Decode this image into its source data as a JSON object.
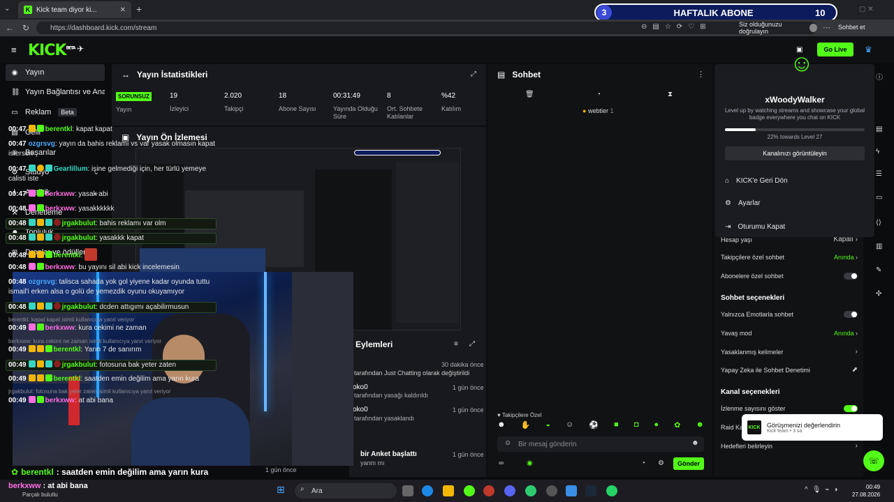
{
  "browser": {
    "tab_title": "Kick team diyor ki...",
    "url": "https://dashboard.kick.com/stream",
    "verify_label": "Siz olduğunuzu doğrulayın",
    "subscribe_label": "Sohbet et"
  },
  "sub_overlay": {
    "count_left": "3",
    "label": "HAFTALIK ABONE",
    "count_right": "10"
  },
  "header": {
    "logo": "KICK",
    "logo_sup": "BETA",
    "go_live": "Go Live"
  },
  "sidebar": {
    "items": [
      {
        "label": "Yayın"
      },
      {
        "label": "Yayın Bağlantısı ve Anahtarı"
      },
      {
        "label": "Reklam",
        "badge": "Beta"
      },
      {
        "label": "Gelir"
      },
      {
        "label": "Başarılar"
      },
      {
        "label": "Stüdyo"
      },
      {
        "label": "Analitik"
      },
      {
        "label": "Denetleme"
      },
      {
        "label": "Topluluk"
      },
      {
        "label": "Droplar ve ödüller"
      }
    ]
  },
  "stats": {
    "title": "Yayın İstatistikleri",
    "badge": "SORUNSUZ",
    "items": [
      {
        "value": "",
        "label": "Yayın"
      },
      {
        "value": "19",
        "label": "İzleyici"
      },
      {
        "value": "2.020",
        "label": "Takipçi"
      },
      {
        "value": "18",
        "label": "Abone Sayısı"
      },
      {
        "value": "00:31:49",
        "label": "Yayında Olduğu Süre"
      },
      {
        "value": "8",
        "label": "Ort. Sohbete Katılanlar"
      },
      {
        "value": "%42",
        "label": "Katılım"
      }
    ]
  },
  "preview": {
    "title": "Yayın Ön İzlemesi"
  },
  "actions": {
    "title": "Eylemleri",
    "rows": [
      {
        "time": "30 dakika önce",
        "text": "tarafından Just Chatting olarak değiştirildi"
      },
      {
        "time": "1 gün önce",
        "text": "oko0",
        "sub": "tarafından yasağı kaldırıldı"
      },
      {
        "time": "1 gün önce",
        "text": "oko0",
        "sub": "tarafından yasaklandı"
      },
      {
        "time": "1 gün önce",
        "text": "bir Anket başlattı",
        "sub": "yanm mı"
      },
      {
        "time": "1 gün önce",
        "text": ""
      }
    ]
  },
  "chat": {
    "title": "Sohbet",
    "pinned": "webtier",
    "pinned_count": "1",
    "messages": [
      {
        "time": "00:47",
        "user": "berentkl",
        "color": "#53fc18",
        "text": "kapat kapat",
        "hl": false
      },
      {
        "time": "00:47",
        "user": "ozgrsvg",
        "color": "#4aa8ff",
        "text": "yayın da bahis reklamı vs var yasak olmasın kapat istersen",
        "hl": false
      },
      {
        "time": "00:47",
        "user": "Gearlillum",
        "color": "#38d6c2",
        "text": "işine gelmediği için, her türlü yemeye calisti iste",
        "hl": false
      },
      {
        "time": "00:47",
        "user": "berkxww",
        "color": "#ff6ee2",
        "text": "yasak abi",
        "hl": false
      },
      {
        "time": "00:48",
        "user": "berkxww",
        "color": "#ff6ee2",
        "text": "yasakkkkkk",
        "hl": false
      },
      {
        "time": "00:48",
        "user": "jrgakbulut",
        "color": "#53fc18",
        "text": "bahis reklamı var olm",
        "hl": true
      },
      {
        "time": "00:48",
        "user": "jrgakbulut",
        "color": "#53fc18",
        "text": "yasakkk kapat",
        "hl": true
      },
      {
        "time": "00:48",
        "user": "berentkl",
        "color": "#53fc18",
        "text": "",
        "hl": false
      },
      {
        "time": "00:48",
        "user": "berkxww",
        "color": "#ff6ee2",
        "text": "bu yayını sil abi kick incelemesin",
        "hl": false
      },
      {
        "time": "00:48",
        "user": "ozgrsvg",
        "color": "#4aa8ff",
        "text": "talisca sahada yok gol yiyene kadar oyunda tuttu ismail'i erken alsa o golü de yemezdik oyunu okuyamıyor",
        "hl": false
      },
      {
        "time": "00:48",
        "user": "jrgakbulut",
        "color": "#53fc18",
        "text": "dcden attıgımı açabilirmusun",
        "hl": true
      },
      {
        "time": "00:49",
        "user": "berkxww",
        "color": "#ff6ee2",
        "text": "kura cekimi ne zaman",
        "hl": false,
        "reply": "berentkl: kapat kapat isimli kullanıcıya yanıt veriyor"
      },
      {
        "time": "00:49",
        "user": "berentkl",
        "color": "#53fc18",
        "text": "Yarın 7 de sanırım",
        "hl": false,
        "reply": "berkxww: kura cekimi ne zaman isimli kullanıcıya yanıt veriyor"
      },
      {
        "time": "00:49",
        "user": "jrgakbulut",
        "color": "#53fc18",
        "text": "fotosuna bak yeter zaten",
        "hl": true
      },
      {
        "time": "00:49",
        "user": "berentkl",
        "color": "#53fc18",
        "text": "saatden emin değilim ama yarın kura",
        "hl": false
      },
      {
        "time": "00:49",
        "user": "berkxww",
        "color": "#ff6ee2",
        "text": "at abi bana",
        "hl": false,
        "reply": "jrgakbulut: fotosuna bak yeter zaten isimli kullanıcıya yanıt veriyor"
      }
    ],
    "followers_label": "Takipçilere Özel",
    "input_placeholder": "Bir mesaj gönderin",
    "send_label": "Gönder"
  },
  "dropdown": {
    "username": "xWoodyWalker",
    "tagline": "Level up by watching streams and showcase your global badge everywhere you chat on KICK",
    "progress_text": "22% towards Level 27",
    "progress_pct": 22,
    "view_channel": "Kanalınızı görüntüleyin",
    "items": [
      "KICK'e Geri Dön",
      "Ayarlar",
      "Oturumu Kapat"
    ]
  },
  "settings": {
    "rows": [
      {
        "label": "Hesap yaşı",
        "value": "Kapalı",
        "type": "arrow"
      },
      {
        "label": "Takipçilere özel sohbet",
        "value": "Anında",
        "type": "value"
      },
      {
        "label": "Abonelere özel sohbet",
        "value": "",
        "type": "toggle"
      }
    ],
    "chat_options_title": "Sohbet seçenekleri",
    "chat_options": [
      {
        "label": "Yalnızca Emotlarla sohbet",
        "value": "",
        "type": "toggle"
      },
      {
        "label": "Yavaş mod",
        "value": "Anında",
        "type": "value"
      },
      {
        "label": "Yasaklanmış kelimeler",
        "value": "",
        "type": "arrow"
      },
      {
        "label": "Yapay Zeka ile Sohbet Denetimi",
        "value": "",
        "type": "ext"
      }
    ],
    "channel_options_title": "Kanal seçenekleri",
    "channel_options": [
      {
        "label": "İzlenme sayısını göster",
        "value": "",
        "type": "toggle-on"
      },
      {
        "label": "Raid Ka",
        "value": "",
        "type": "none"
      },
      {
        "label": "Hedefleri belirleyin",
        "value": "",
        "type": "arrow"
      }
    ]
  },
  "toast": {
    "logo": "KICK",
    "title": "Görüşmenizi değerlendirin",
    "sub": "Kick team • 3 sa"
  },
  "overlay_subtitle": {
    "user": "berentkl",
    "text": ": saatden emin değilim ama yarın kura"
  },
  "taskbar_notice": {
    "user": "berkxww",
    "text": ": at abi bana",
    "sub": "Parçalı bulutlu"
  },
  "taskbar": {
    "search": "Ara",
    "time": "00:49",
    "date": "27.08.2026"
  },
  "colors": {
    "accent": "#53fc18",
    "bg": "#0b0c0e",
    "panel": "#18191c"
  }
}
